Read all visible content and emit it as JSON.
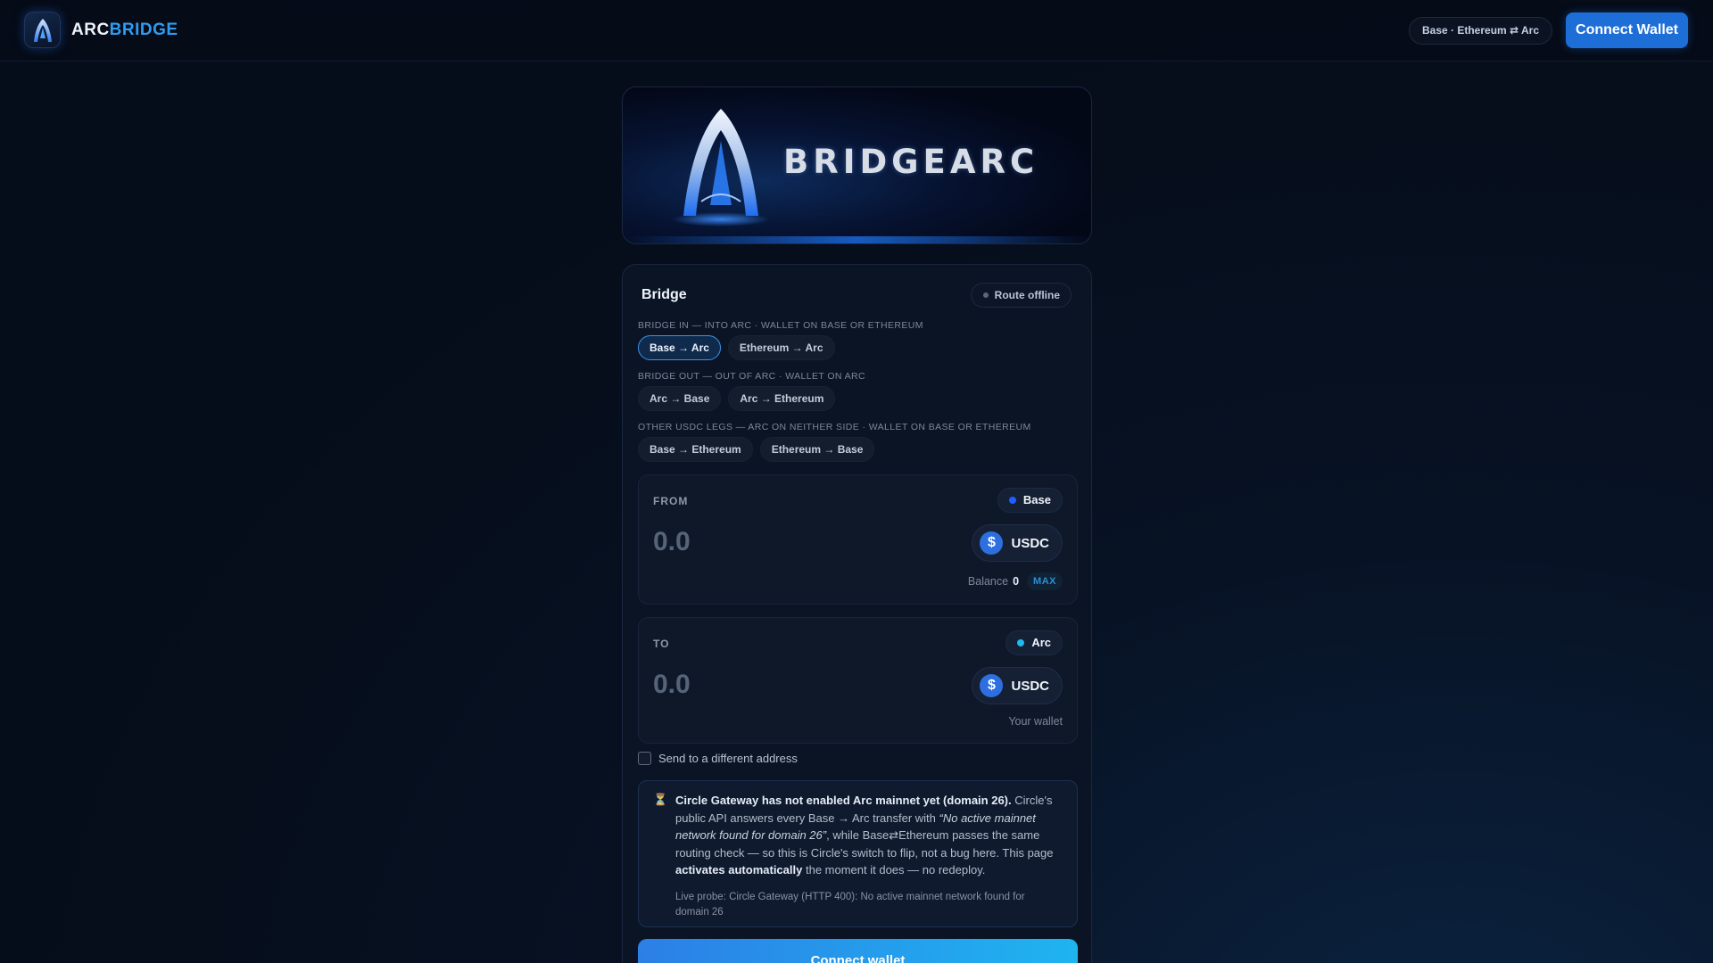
{
  "header": {
    "brand_part1": "ARC",
    "brand_part2": "BRIDGE",
    "network_pill": "Base · Ethereum ⇄ Arc",
    "connect_label": "Connect Wallet"
  },
  "banner": {
    "title": "BRIDGEARC"
  },
  "bridge": {
    "title": "Bridge",
    "status": "Route offline",
    "sections": [
      {
        "label": "BRIDGE IN — INTO ARC · WALLET ON BASE OR ETHEREUM",
        "routes": [
          {
            "label": "Base → Arc",
            "active": true
          },
          {
            "label": "Ethereum → Arc",
            "active": false
          }
        ]
      },
      {
        "label": "BRIDGE OUT — OUT OF ARC · WALLET ON ARC",
        "routes": [
          {
            "label": "Arc → Base",
            "active": false
          },
          {
            "label": "Arc → Ethereum",
            "active": false
          }
        ]
      },
      {
        "label": "OTHER USDC LEGS — ARC ON NEITHER SIDE · WALLET ON BASE OR ETHEREUM",
        "routes": [
          {
            "label": "Base → Ethereum",
            "active": false
          },
          {
            "label": "Ethereum → Base",
            "active": false
          }
        ]
      }
    ],
    "from": {
      "label": "FROM",
      "network": "Base",
      "network_color": "#1f5fff",
      "amount_placeholder": "0.0",
      "token": "USDC",
      "balance_label": "Balance",
      "balance_value": "0",
      "max_label": "MAX"
    },
    "to": {
      "label": "TO",
      "network": "Arc",
      "network_color": "#22b8f0",
      "amount_placeholder": "0.0",
      "token": "USDC",
      "hint": "Your wallet"
    },
    "different_address_label": "Send to a different address",
    "notice": {
      "bold_intro": "Circle Gateway has not enabled Arc mainnet yet (domain 26).",
      "text_1": " Circle's public API answers every Base → Arc transfer with ",
      "italic_quote": "“No active mainnet network found for domain 26”",
      "text_2": ", while Base⇄Ethereum passes the same routing check — so this is Circle's switch to flip, not a bug here. This page ",
      "bold_auto": "activates automatically",
      "text_3": " the moment it does — no redeploy.",
      "probe": "Live probe: Circle Gateway (HTTP 400): No active mainnet network found for domain 26"
    },
    "connect_label": "Connect wallet"
  },
  "colors": {
    "accent": "#2f9cf2",
    "primary_button": "#1e6ed8"
  }
}
